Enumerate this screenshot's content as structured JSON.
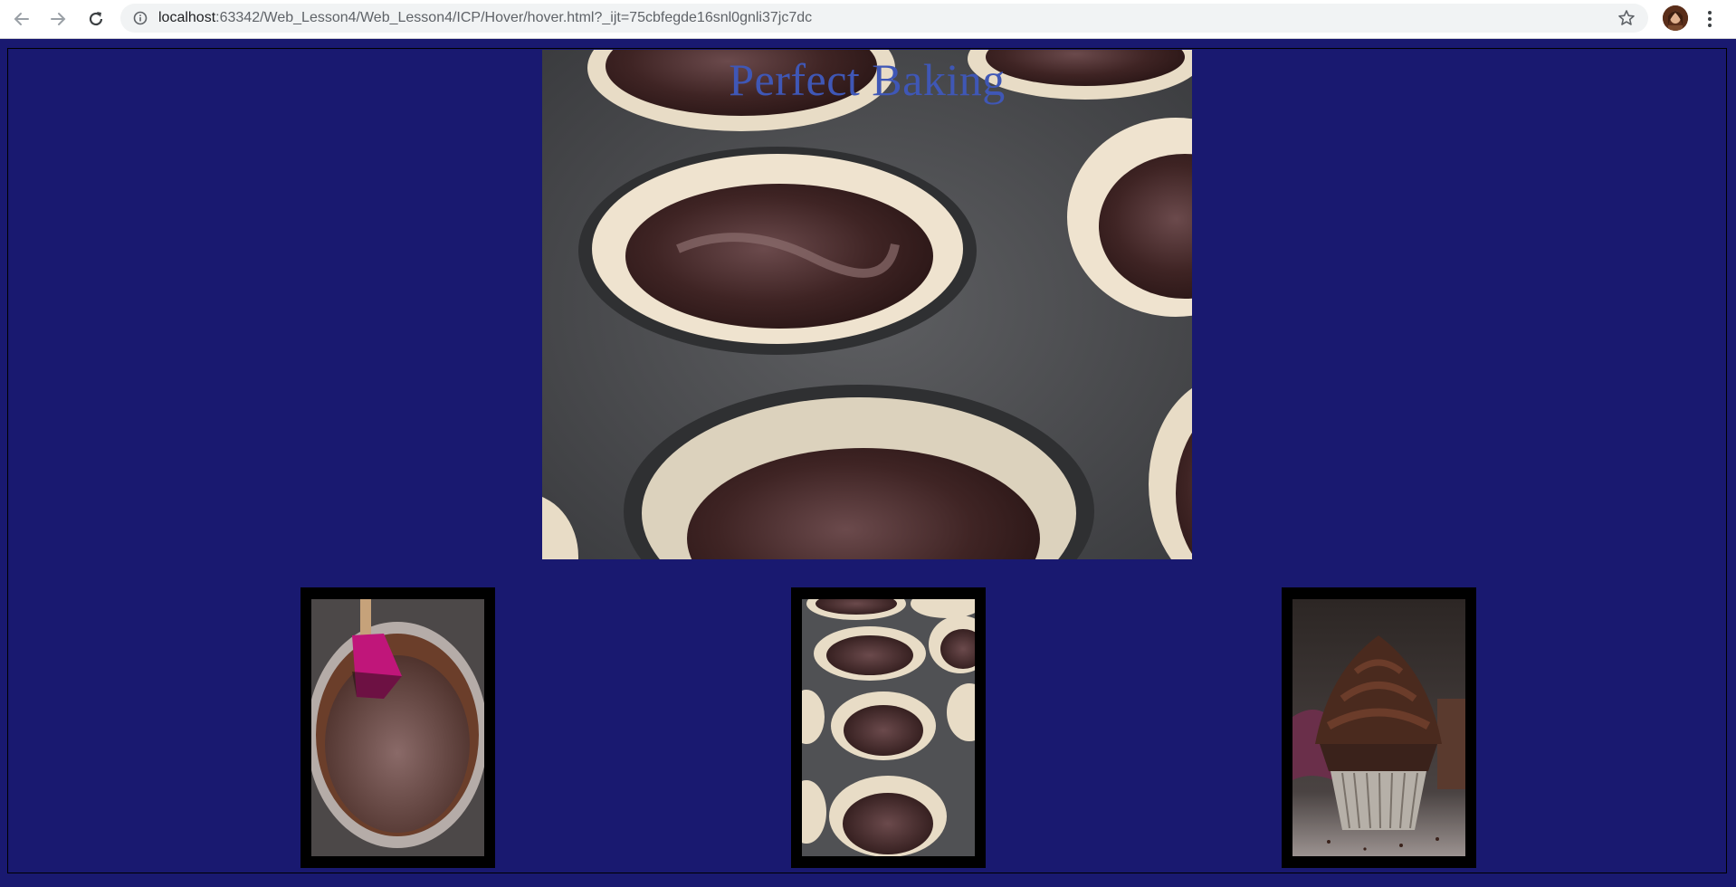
{
  "browser": {
    "url_host": "localhost",
    "url_rest": ":63342/Web_Lesson4/Web_Lesson4/ICP/Hover/hover.html?_ijt=75cbfegde16snl0gnli37jc7dc",
    "icons": {
      "back": "arrow-left-icon",
      "forward": "arrow-right-icon",
      "reload": "reload-icon",
      "info": "info-icon",
      "bookmark": "star-icon",
      "menu": "kebab-menu-icon"
    }
  },
  "page": {
    "title": "Perfect Baking",
    "background": "#191970",
    "title_color": "#3f57b6",
    "thumbnails": [
      {
        "name": "chocolate-batter-bowl"
      },
      {
        "name": "cupcake-liners-batter"
      },
      {
        "name": "frosted-chocolate-cupcake"
      }
    ]
  }
}
